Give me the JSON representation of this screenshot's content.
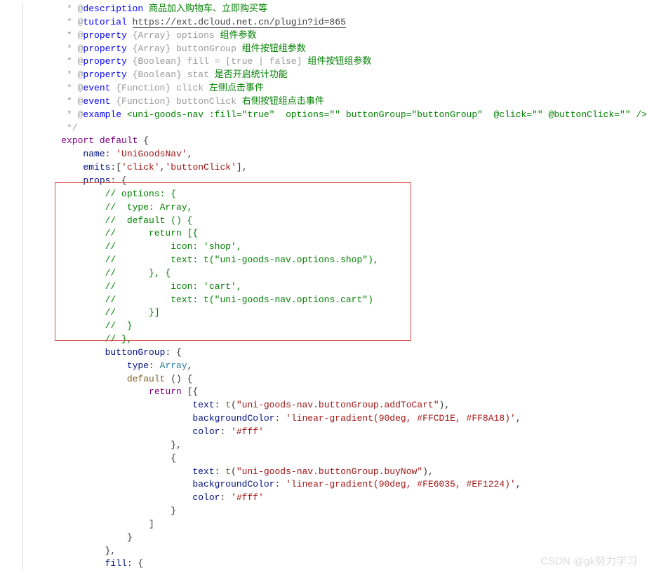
{
  "watermark": "CSDN @gk努力学习",
  "code": {
    "l1": {
      "prefix": "     * @",
      "tag": "description",
      "text": " 商品加入购物车、立即购买等"
    },
    "l2": {
      "prefix": "     * @",
      "tag": "tutorial",
      "url": "https://ext.dcloud.net.cn/plugin?id=865"
    },
    "l3": {
      "prefix": "     * @",
      "tag": "property",
      "type": "{Array}",
      "name": " options ",
      "desc": "组件参数"
    },
    "l4": {
      "prefix": "     * @",
      "tag": "property",
      "type": "{Array}",
      "name": " buttonGroup ",
      "desc": "组件按钮组参数"
    },
    "l5": {
      "prefix": "     * @",
      "tag": "property",
      "type": "{Boolean}",
      "name": " fill = [true | false] ",
      "desc": "组件按钮组参数"
    },
    "l6": {
      "prefix": "     * @",
      "tag": "property",
      "type": "{Boolean}",
      "name": " stat ",
      "desc": "是否开启统计功能"
    },
    "l7": {
      "prefix": "     * @",
      "tag": "event",
      "type": "{Function}",
      "name": " click ",
      "desc": "左侧点击事件"
    },
    "l8": {
      "prefix": "     * @",
      "tag": "event",
      "type": "{Function}",
      "name": " buttonClick ",
      "desc": "右侧按钮组点击事件"
    },
    "l9": {
      "prefix": "     * @",
      "tag": "example",
      "text": " <uni-goods-nav :fill=\"true\"  options=\"\" buttonGroup=\"buttonGroup\"  @click=\"\" @buttonClick=\"\" />"
    },
    "l10": "     */",
    "l11_export": "    export",
    "l11_default": " default",
    "l11_brace": " {",
    "l12_name": "        name",
    "l12_colon": ": ",
    "l12_val": "'UniGoodsNav'",
    "l12_comma": ",",
    "l13_emits": "        emits",
    "l13_colon": ":[",
    "l13_v1": "'click'",
    "l13_c": ",",
    "l13_v2": "'buttonClick'",
    "l13_end": "],",
    "l14": "        props",
    "l14_end": ": {",
    "c1": "            // options: {",
    "c2": "            //  type: Array,",
    "c3": "            //  default () {",
    "c4": "            //      return [{",
    "c5": "            //          icon: 'shop',",
    "c6": "            //          text: t(\"uni-goods-nav.options.shop\"),",
    "c7": "            //      }, {",
    "c8": "            //          icon: 'cart',",
    "c9": "            //          text: t(\"uni-goods-nav.options.cart\")",
    "c10": "            //      }]",
    "c11": "            //  }",
    "c12": "            // },",
    "bg1": "            buttonGroup",
    "bg1_end": ": {",
    "bg2": "                type",
    "bg2_mid": ": ",
    "bg2_val": "Array",
    "bg2_end": ",",
    "bg3": "                default",
    "bg3_end": " () {",
    "bg4": "                    return",
    "bg4_end": " [{",
    "bg5_prop": "                            text",
    "bg5_mid": ": ",
    "bg5_fn": "t",
    "bg5_p": "(",
    "bg5_str": "\"uni-goods-nav.buttonGroup.addToCart\"",
    "bg5_end": "),",
    "bg6_prop": "                            backgroundColor",
    "bg6_mid": ": ",
    "bg6_str": "'linear-gradient(90deg, #FFCD1E, #FF8A18)'",
    "bg6_end": ",",
    "bg7_prop": "                            color",
    "bg7_mid": ": ",
    "bg7_str": "'#fff'",
    "bg8": "                        },",
    "bg9": "                        {",
    "bg10_prop": "                            text",
    "bg10_mid": ": ",
    "bg10_fn": "t",
    "bg10_p": "(",
    "bg10_str": "\"uni-goods-nav.buttonGroup.buyNow\"",
    "bg10_end": "),",
    "bg11_prop": "                            backgroundColor",
    "bg11_mid": ": ",
    "bg11_str": "'linear-gradient(90deg, #FE6035, #EF1224)'",
    "bg11_end": ",",
    "bg12_prop": "                            color",
    "bg12_mid": ": ",
    "bg12_str": "'#fff'",
    "bg13": "                        }",
    "bg14": "                    ]",
    "bg15": "                }",
    "bg16": "            },",
    "fill": "            fill",
    "fill_end": ": {"
  }
}
